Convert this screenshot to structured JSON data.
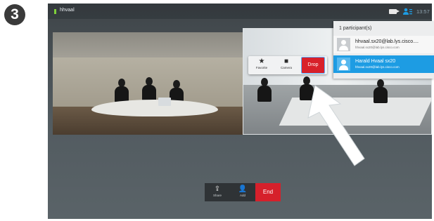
{
  "step_number": "3",
  "call": {
    "caller_name": "hhvaal",
    "time": "13:57"
  },
  "participant_list": {
    "header": "1 participant(s)",
    "items": [
      {
        "name": "hhvaal.sx20@lab.lys.cisco....",
        "address": "hhvaal.sx20@lab.lys.cisco.com",
        "selected": false
      },
      {
        "name": "Harald Hvaal sx20",
        "address": "hhvaal.sx20@lab.lys.cisco.com",
        "selected": true
      }
    ]
  },
  "context_menu": {
    "favorite_label": "Favorite",
    "camera_label": "Camera",
    "drop_label": "Drop"
  },
  "call_controls": {
    "share_label": "Share",
    "add_label": "Add",
    "end_label": "End"
  },
  "colors": {
    "accent_blue": "#1d9ce3",
    "danger_red": "#d6202b",
    "status_green": "#7fd03a"
  }
}
